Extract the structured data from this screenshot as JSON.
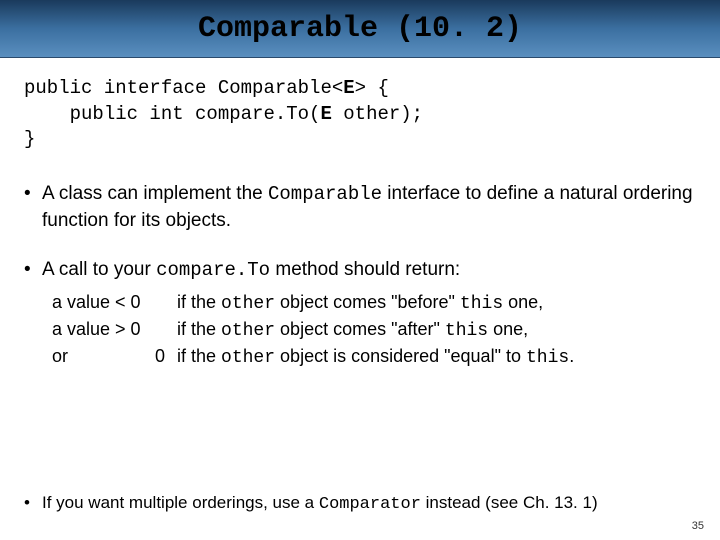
{
  "header": {
    "title_word": "Comparable",
    "title_section": " (10. 2)"
  },
  "code": {
    "line1a": "public interface Comparable<",
    "line1b": "E",
    "line1c": "> {",
    "line2a": "    public int compare.To(",
    "line2b": "E",
    "line2c": " other);",
    "line3": "}"
  },
  "bullets": {
    "b1_part1": "A class can implement the ",
    "b1_mono1": "Comparable",
    "b1_part2": " interface to define a natural ordering function for its objects.",
    "b2_part1": "A call to your ",
    "b2_mono1": "compare.To",
    "b2_part2": " method should return:"
  },
  "table": {
    "r1c1": "a value < 0",
    "r1_t1": "if the ",
    "r1_m1": "other",
    "r1_t2": " object comes \"before\" ",
    "r1_m2": "this",
    "r1_t3": " one,",
    "r2c1": "a value > 0",
    "r2_t1": "if the ",
    "r2_m1": "other",
    "r2_t2": " object comes \"after\" ",
    "r2_m2": "this",
    "r2_t3": " one,",
    "r3c1a": "or",
    "r3c1b": "0",
    "r3_t1": "if the ",
    "r3_m1": "other",
    "r3_t2": " object is considered \"equal\" to ",
    "r3_m2": "this",
    "r3_t3": "."
  },
  "footer": {
    "f_t1": "If you want multiple orderings, use a ",
    "f_m1": "Comparator",
    "f_t2": " instead (see Ch. 13. 1)"
  },
  "page": "35"
}
